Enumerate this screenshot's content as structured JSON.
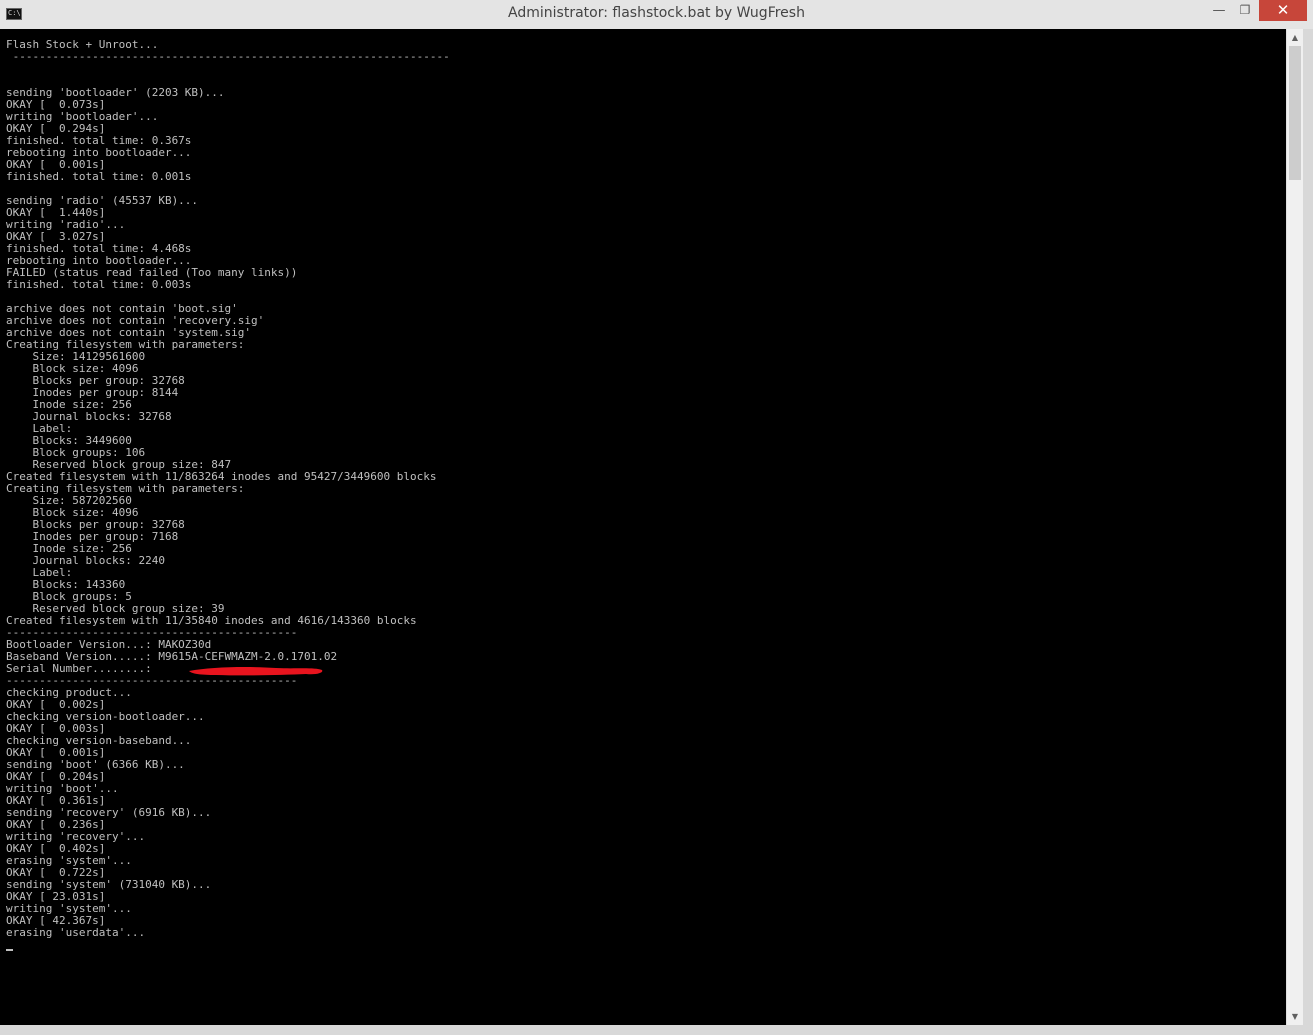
{
  "window": {
    "title": "Administrator:  flashstock.bat by WugFresh",
    "icon": "cmd-icon",
    "icon_glyph": "C:\\",
    "minimize_glyph": "—",
    "maximize_glyph": "❐",
    "close_glyph": "✕"
  },
  "console": {
    "text_color": "#c0c0c0",
    "background": "#000000",
    "lines": [
      "Flash Stock + Unroot...",
      " ------------------------------------------------------------------",
      "",
      "",
      "sending 'bootloader' (2203 KB)...",
      "OKAY [  0.073s]",
      "writing 'bootloader'...",
      "OKAY [  0.294s]",
      "finished. total time: 0.367s",
      "rebooting into bootloader...",
      "OKAY [  0.001s]",
      "finished. total time: 0.001s",
      "",
      "sending 'radio' (45537 KB)...",
      "OKAY [  1.440s]",
      "writing 'radio'...",
      "OKAY [  3.027s]",
      "finished. total time: 4.468s",
      "rebooting into bootloader...",
      "FAILED (status read failed (Too many links))",
      "finished. total time: 0.003s",
      "",
      "archive does not contain 'boot.sig'",
      "archive does not contain 'recovery.sig'",
      "archive does not contain 'system.sig'",
      "Creating filesystem with parameters:",
      "    Size: 14129561600",
      "    Block size: 4096",
      "    Blocks per group: 32768",
      "    Inodes per group: 8144",
      "    Inode size: 256",
      "    Journal blocks: 32768",
      "    Label:",
      "    Blocks: 3449600",
      "    Block groups: 106",
      "    Reserved block group size: 847",
      "Created filesystem with 11/863264 inodes and 95427/3449600 blocks",
      "Creating filesystem with parameters:",
      "    Size: 587202560",
      "    Block size: 4096",
      "    Blocks per group: 32768",
      "    Inodes per group: 7168",
      "    Inode size: 256",
      "    Journal blocks: 2240",
      "    Label:",
      "    Blocks: 143360",
      "    Block groups: 5",
      "    Reserved block group size: 39",
      "Created filesystem with 11/35840 inodes and 4616/143360 blocks",
      "--------------------------------------------",
      "Bootloader Version...: MAKOZ30d",
      "Baseband Version.....: M9615A-CEFWMAZM-2.0.1701.02",
      "Serial Number........: ",
      "--------------------------------------------",
      "checking product...",
      "OKAY [  0.002s]",
      "checking version-bootloader...",
      "OKAY [  0.003s]",
      "checking version-baseband...",
      "OKAY [  0.001s]",
      "sending 'boot' (6366 KB)...",
      "OKAY [  0.204s]",
      "writing 'boot'...",
      "OKAY [  0.361s]",
      "sending 'recovery' (6916 KB)...",
      "OKAY [  0.236s]",
      "writing 'recovery'...",
      "OKAY [  0.402s]",
      "erasing 'system'...",
      "OKAY [  0.722s]",
      "sending 'system' (731040 KB)...",
      "OKAY [ 23.031s]",
      "writing 'system'...",
      "OKAY [ 42.367s]",
      "erasing 'userdata'..."
    ],
    "redaction_color": "#e8141e"
  },
  "scrollbar": {
    "up_glyph": "▲",
    "down_glyph": "▼"
  }
}
